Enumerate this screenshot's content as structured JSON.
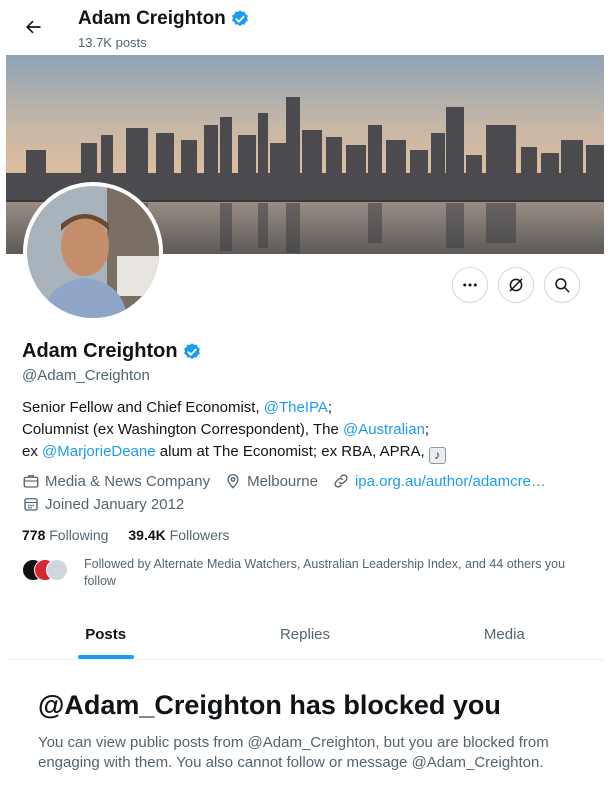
{
  "header": {
    "name": "Adam Creighton",
    "posts": "13.7K posts"
  },
  "profile": {
    "name": "Adam Creighton",
    "handle": "@Adam_Creighton",
    "bio": {
      "line1_text": "Senior Fellow and Chief Economist, ",
      "line1_link": "@TheIPA",
      "line1_end": ";",
      "line2_text": "Columnist (ex Washington Correspondent), The ",
      "line2_link": "@Australian",
      "line2_end": ";",
      "line3_pre": "ex ",
      "line3_link": "@MarjorieDeane",
      "line3_text": " alum at The Economist; ex RBA, APRA, "
    },
    "category": "Media & News Company",
    "location": "Melbourne",
    "website": "ipa.org.au/author/adamcre…",
    "joined": "Joined January 2012",
    "following_count": "778",
    "following_label": "Following",
    "followers_count": "39.4K",
    "followers_label": "Followers",
    "followed_by": "Followed by Alternate Media Watchers, Australian Leadership Index, and 44 others you follow"
  },
  "icons": {
    "back": "arrow-left-icon",
    "verified": "verified-badge-icon",
    "more": "more-icon",
    "grok": "grok-icon",
    "search": "search-icon",
    "category": "briefcase-icon",
    "location": "location-pin-icon",
    "website": "link-icon",
    "joined": "calendar-icon"
  },
  "tabs": [
    {
      "label": "Posts",
      "active": true
    },
    {
      "label": "Replies",
      "active": false
    },
    {
      "label": "Media",
      "active": false
    }
  ],
  "blocked": {
    "title": "@Adam_Creighton has blocked you",
    "message": "You can view public posts from @Adam_Creighton, but you are blocked from engaging with them. You also cannot follow or message @Adam_Creighton."
  },
  "colors": {
    "accent": "#1d9bf0",
    "text": "#0f1419",
    "secondary": "#536471",
    "border": "#cfd9de"
  }
}
